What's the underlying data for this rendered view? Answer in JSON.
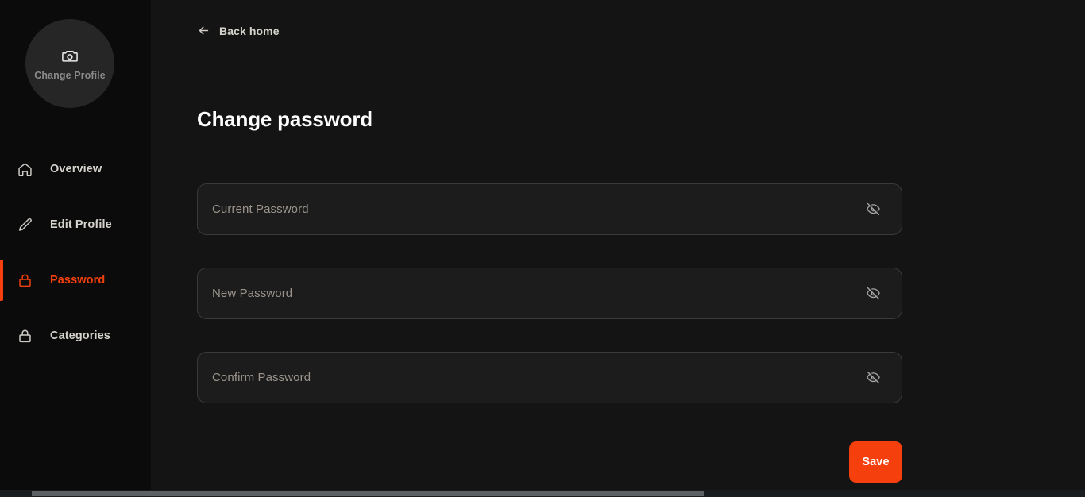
{
  "theme": {
    "accent": "#f5400d",
    "sidebar_bg": "#0b0b0b",
    "main_bg": "#141414",
    "field_bg": "#1c1c1c",
    "field_border": "#3a3a3a",
    "text_primary": "#ffffff",
    "text_muted": "#9b958d"
  },
  "sidebar": {
    "avatar": {
      "label": "Change Profile",
      "icon": "camera-icon"
    },
    "items": [
      {
        "label": "Overview",
        "icon": "home-icon",
        "active": false
      },
      {
        "label": "Edit Profile",
        "icon": "pencil-icon",
        "active": false
      },
      {
        "label": "Password",
        "icon": "lock-icon",
        "active": true
      },
      {
        "label": "Categories",
        "icon": "lock-icon",
        "active": false
      }
    ]
  },
  "main": {
    "back_link": {
      "label": "Back home",
      "icon": "arrow-left-icon"
    },
    "title": "Change password",
    "fields": [
      {
        "placeholder": "Current Password",
        "value": "",
        "toggle_icon": "eye-off-icon"
      },
      {
        "placeholder": "New Password",
        "value": "",
        "toggle_icon": "eye-off-icon"
      },
      {
        "placeholder": "Confirm Password",
        "value": "",
        "toggle_icon": "eye-off-icon"
      }
    ],
    "save_label": "Save"
  }
}
